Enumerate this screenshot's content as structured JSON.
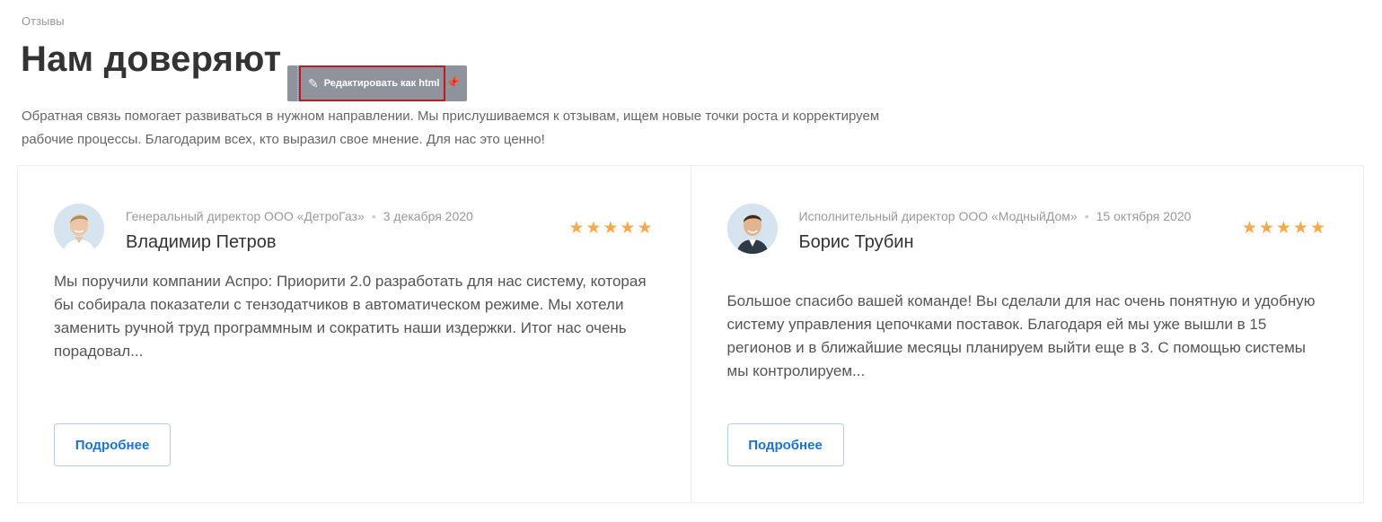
{
  "breadcrumb": "Отзывы",
  "title": "Нам доверяют",
  "toolbar": {
    "edit_label": "Редактировать как html",
    "pencil_icon": "pencil-icon",
    "pin_icon": "pin-icon"
  },
  "intro": "Обратная связь помогает развиваться в нужном направлении. Мы прислушиваемся к отзывам, ищем новые точки роста и корректируем рабочие процессы. Благодарим всех, кто выразил свое мнение. Для нас это ценно!",
  "reviews": [
    {
      "position": "Генеральный директор ООО «ДетроГаз»",
      "date": "3 декабря 2020",
      "name": "Владимир Петров",
      "rating": 5,
      "stars": "★★★★★",
      "text": "Мы поручили компании Аспро: Приорити 2.0 разработать для нас систему, которая бы собирала показатели с тензодатчиков в автоматическом режиме. Мы хотели заменить ручной труд программным и сократить наши издержки. Итог нас очень порадовал...",
      "button": "Подробнее"
    },
    {
      "position": "Исполнительный директор ООО «МодныйДом»",
      "date": "15 октября 2020",
      "name": "Борис Трубин",
      "rating": 5,
      "stars": "★★★★★",
      "text": "Большое спасибо вашей команде! Вы сделали для нас очень понятную и удобную систему управления цепочками поставок. Благодаря ей мы уже вышли в 15 регионов и в ближайшие месяцы планируем выйти еще в 3. С помощью системы мы контролируем...",
      "button": "Подробнее"
    }
  ],
  "colors": {
    "accent": "#1a73d9",
    "star": "#f9a94b",
    "toolbar": "#8f949c",
    "highlight_border": "#c0191f"
  }
}
